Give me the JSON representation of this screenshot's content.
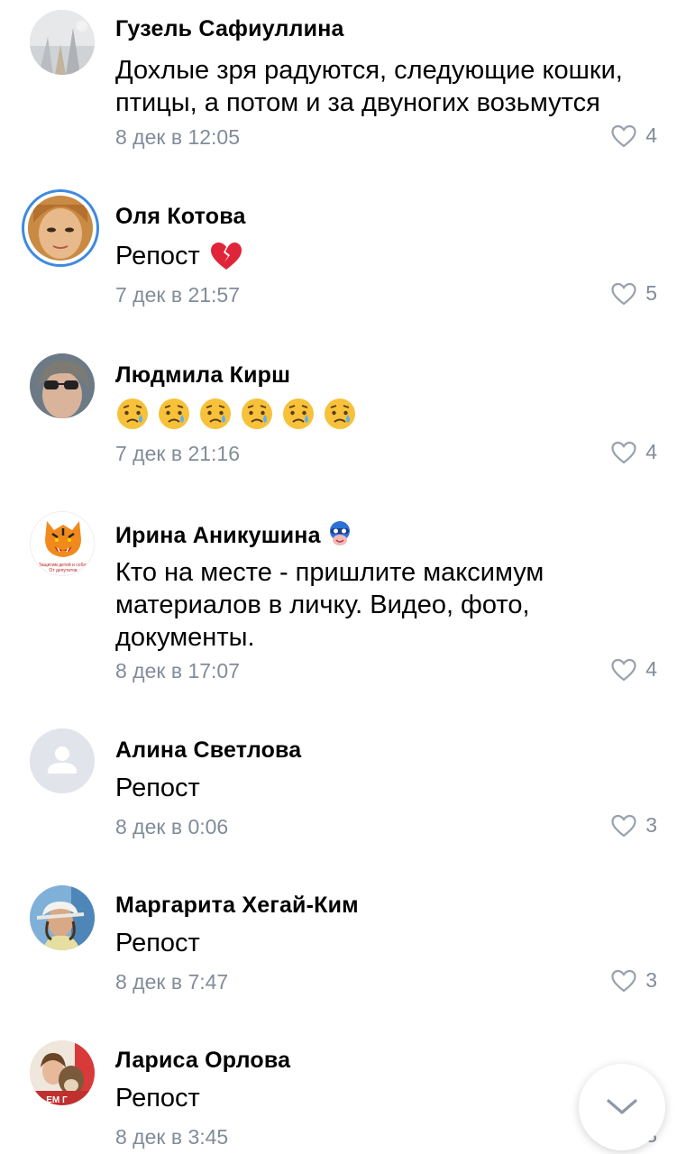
{
  "comments": [
    {
      "author": "Гузель Сафиуллина",
      "text_lines": [
        "Дохлые зря радуются, следующие кошки,",
        "птицы, а потом и за двуногих возьмутся"
      ],
      "date": "8 дек в 12:05",
      "likes": "4",
      "avatar": "avatar-photo-icon"
    },
    {
      "author": "Оля Котова",
      "text": "Репост",
      "date": "7 дек в 21:57",
      "likes": "5",
      "avatar": "avatar-photo-icon",
      "emoji": "broken-heart-icon"
    },
    {
      "author": "Людмила Кирш",
      "date": "7 дек в 21:16",
      "likes": "4",
      "avatar": "avatar-photo-icon",
      "emoji": "sad-relieved-face-icon",
      "emoji_count": 6
    },
    {
      "author": "Ирина Аникушина",
      "text_lines": [
        "Кто на месте - пришлите максимум",
        "материалов в личку. Видео, фото,",
        "документы."
      ],
      "date": "8 дек в 17:07",
      "likes": "4",
      "avatar": "tiger-logo-icon",
      "avatar_caption": "Защитим детей и собак От депутатов",
      "badge": "hero-mask-icon"
    },
    {
      "author": "Алина Светлова",
      "text": "Репост",
      "date": "8 дек в 0:06",
      "likes": "3",
      "avatar": "default-user-icon"
    },
    {
      "author": "Маргарита Хегай-Ким",
      "text": "Репост",
      "date": "8 дек в 7:47",
      "likes": "3",
      "avatar": "avatar-photo-icon"
    },
    {
      "author": "Лариса Орлова",
      "text": "Репост",
      "date": "8 дек в 3:45",
      "likes": "3",
      "avatar": "avatar-photo-icon",
      "avatar_caption": "ЕМ Г"
    }
  ],
  "colors": {
    "accent": "#3f8ae0",
    "secondary_text": "#818c99"
  },
  "scroll_button": {
    "icon": "chevron-down-icon"
  }
}
